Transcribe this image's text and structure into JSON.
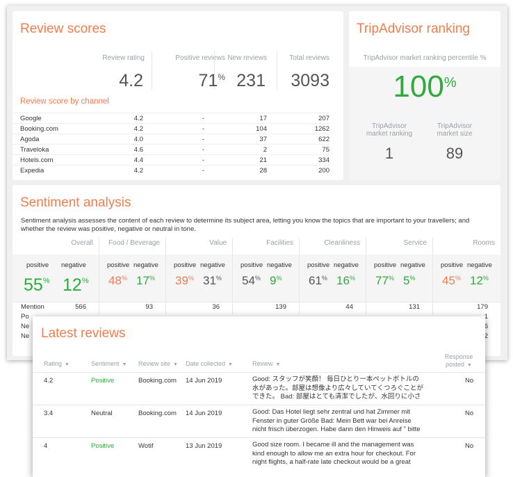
{
  "review_scores": {
    "title": "Review scores",
    "columns": [
      {
        "label": "Review rating",
        "value": "4.2",
        "suffix": ""
      },
      {
        "label": "Positive reviews",
        "value": "71",
        "suffix": "%"
      },
      {
        "label": "New reviews",
        "value": "231",
        "suffix": ""
      },
      {
        "label": "Total reviews",
        "value": "3093",
        "suffix": ""
      }
    ],
    "by_channel_title": "Review score by channel",
    "channels": [
      {
        "name": "Google",
        "rating": "4.2",
        "positive": "-",
        "new": "17",
        "total": "207"
      },
      {
        "name": "Booking.com",
        "rating": "4.2",
        "positive": "-",
        "new": "104",
        "total": "1262"
      },
      {
        "name": "Agoda",
        "rating": "4.0",
        "positive": "-",
        "new": "37",
        "total": "622"
      },
      {
        "name": "Traveloka",
        "rating": "4.6",
        "positive": "-",
        "new": "2",
        "total": "75"
      },
      {
        "name": "Hotels.com",
        "rating": "4.4",
        "positive": "-",
        "new": "21",
        "total": "334"
      },
      {
        "name": "Expedia",
        "rating": "4.2",
        "positive": "-",
        "new": "28",
        "total": "200"
      }
    ]
  },
  "tripadvisor": {
    "title": "TripAdvisor ranking",
    "percentile_label": "TripAdvisor market ranking percentile %",
    "percentile_value": "100",
    "percentile_suffix": "%",
    "ranking_label_1": "TripAdvisor",
    "ranking_label_2": "market ranking",
    "ranking_value": "1",
    "size_label_1": "TripAdvisor",
    "size_label_2": "market size",
    "size_value": "89"
  },
  "sentiment": {
    "title": "Sentiment analysis",
    "description_1": "Sentiment analysis assesses the content of each review to determine its subject area, letting you know the topics that are important to your travellers; and",
    "description_2": "whether the review was positive, negative or neutral in tone.",
    "positive_label": "positive",
    "negative_label": "negative",
    "mention_label": "Mention",
    "row2_label": "Po",
    "row3_label": "Ne",
    "row4_label": "Ne",
    "categories": [
      {
        "name": "Overall",
        "positive": "55",
        "negative": "12",
        "mention": "566"
      },
      {
        "name": "Food / Beverage",
        "positive": "48",
        "negative": "17",
        "mention": "93"
      },
      {
        "name": "Value",
        "positive": "39",
        "negative": "31",
        "mention": "36"
      },
      {
        "name": "Facilities",
        "positive": "54",
        "negative": "9",
        "mention": "139"
      },
      {
        "name": "Cleanliness",
        "positive": "61",
        "negative": "16",
        "mention": "44"
      },
      {
        "name": "Service",
        "positive": "77",
        "negative": "5",
        "mention": "131"
      },
      {
        "name": "Rooms",
        "positive": "45",
        "negative": "12",
        "mention": "179"
      }
    ],
    "rooms_partial": [
      "1",
      "6",
      "2"
    ],
    "colors": {
      "green": "#2eab3b",
      "orange": "#f07d4f",
      "grey": "#555555"
    }
  },
  "latest_reviews": {
    "title": "Latest reviews",
    "headers": {
      "rating": "Rating",
      "sentiment": "Sentiment",
      "site": "Review site",
      "date": "Date collected",
      "review": "Review",
      "response_1": "Response",
      "response_2": "posted"
    },
    "rows": [
      {
        "rating": "4.2",
        "sentiment": "Positive",
        "site": "Booking.com",
        "date": "14 Jun 2019",
        "review_1": "Good: スタッフが笑顔！ 毎日ひとり一本ペットボトルの",
        "review_2": "水があった。部屋は想像より広々していてくつろぐことが",
        "review_3": "できた。 Bad: 部屋はとても清潔でしたが、水回りに小さ",
        "response": "No"
      },
      {
        "rating": "3.4",
        "sentiment": "Neutral",
        "site": "Booking.com",
        "date": "14 Jun 2019",
        "review_1": "Good: Das Hotel liegt sehr zentral und hat Zimmer mit",
        "review_2": "Fenster in guter Größe Bad: Mein Bett war bei Anreise",
        "review_3": "nicht frisch überzogen. Habe dann den Hinweis auf \" bitte",
        "response": "No"
      },
      {
        "rating": "4",
        "sentiment": "Positive",
        "site": "Wotif",
        "date": "13 Jun 2019",
        "review_1": "Good size room. I became ill and the management was",
        "review_2": "kind enough to allow me an extra hour for checkout. For",
        "review_3": "night flights, a half-rate late checkout would be a great",
        "response": "No"
      }
    ]
  }
}
